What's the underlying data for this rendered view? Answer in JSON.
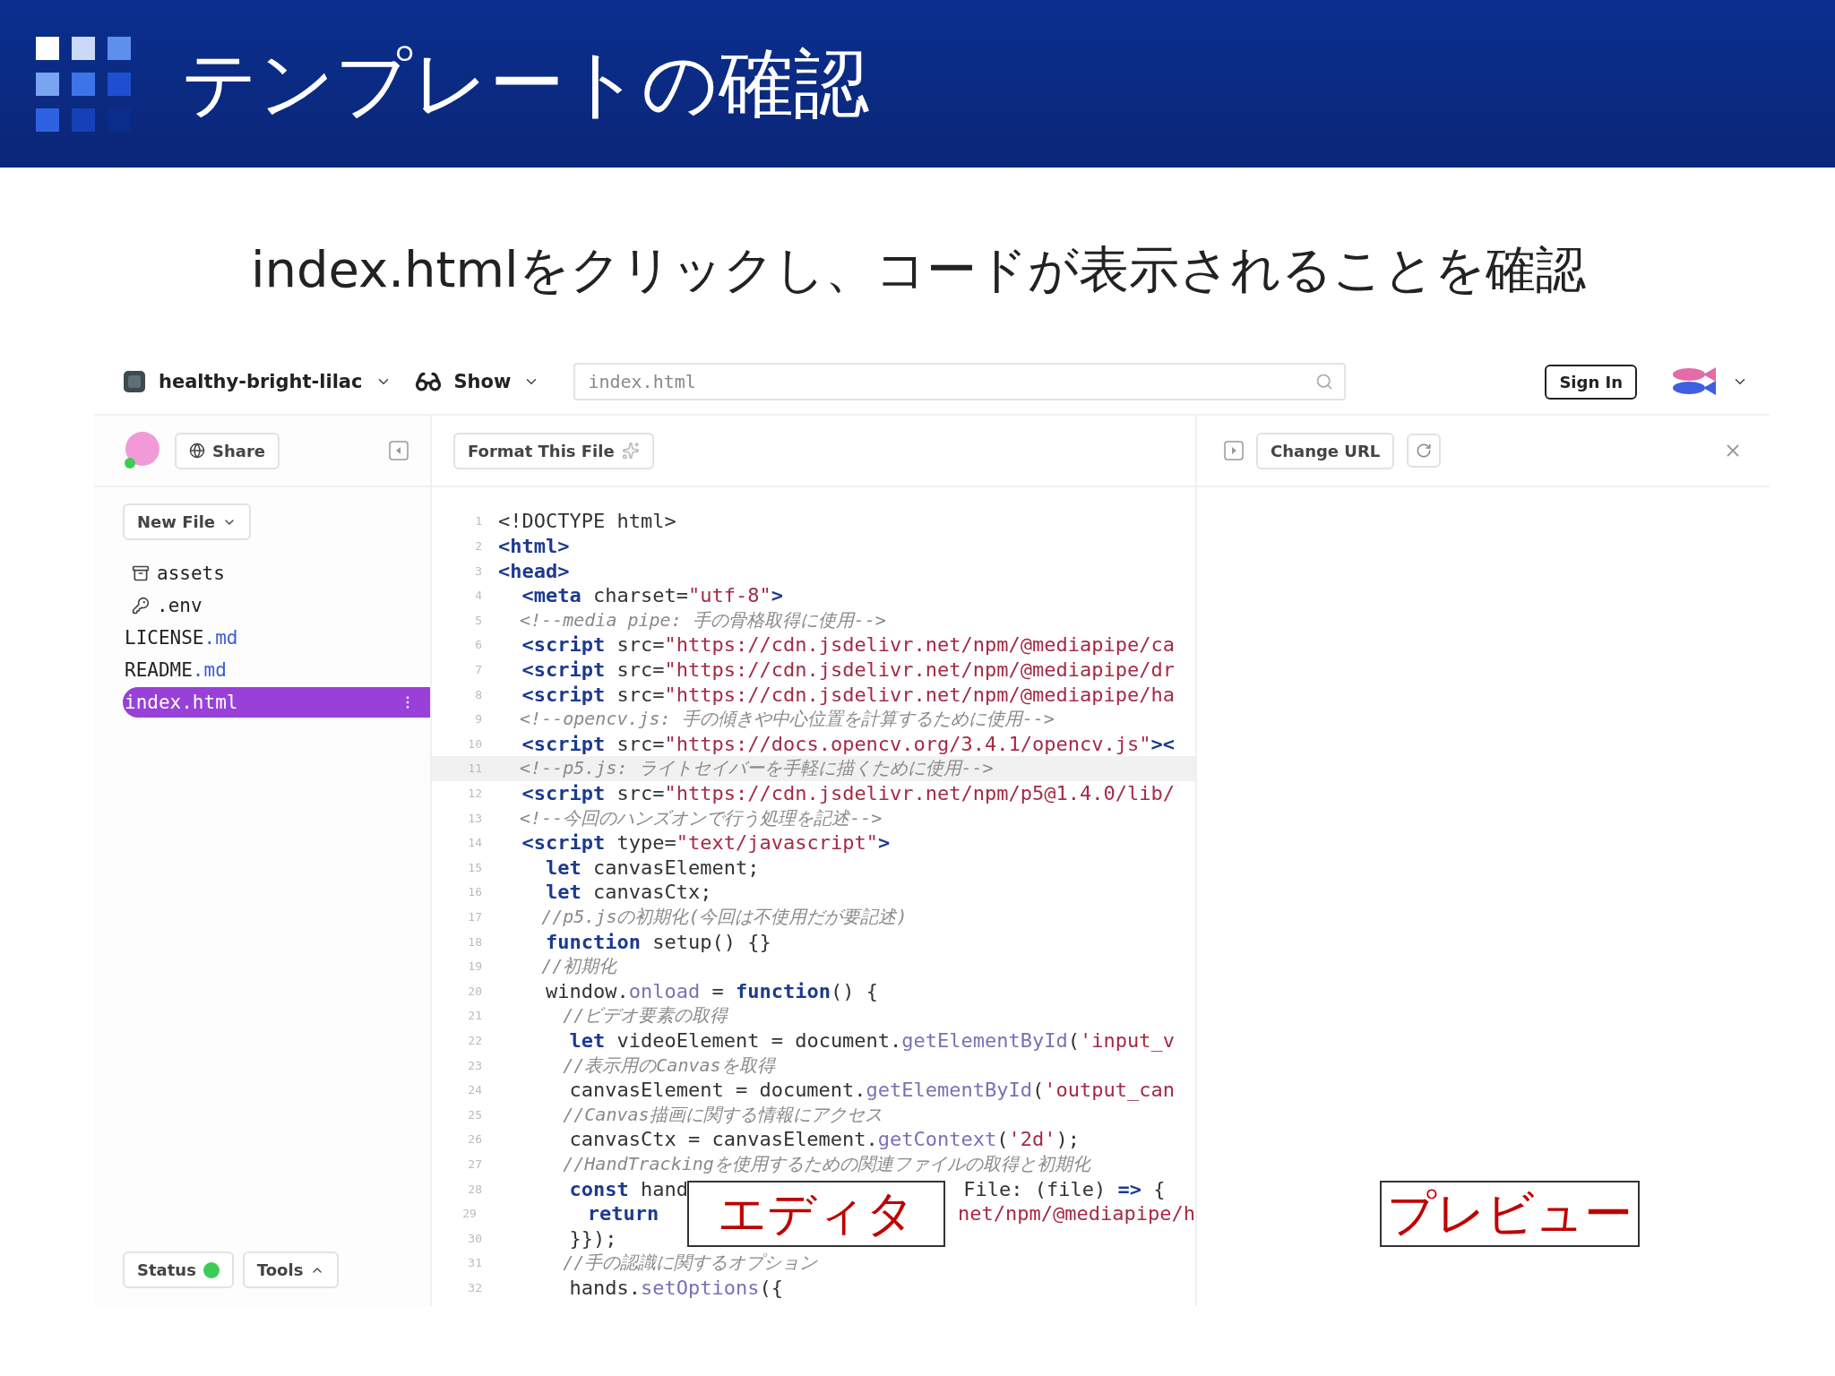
{
  "slide": {
    "title": "テンプレートの確認",
    "subtitle": "index.htmlをクリックし、コードが表示されることを確認"
  },
  "topbar": {
    "project": "healthy-bright-lilac",
    "show": "Show",
    "search": {
      "value": "index.html"
    },
    "sign_in": "Sign In"
  },
  "sidebar": {
    "share": "Share",
    "new_file": "New File",
    "status": "Status",
    "tools": "Tools",
    "files": [
      {
        "kind": "folder",
        "name": "assets",
        "selected": false
      },
      {
        "kind": "env",
        "name": ".env",
        "selected": false
      },
      {
        "kind": "file",
        "name": "LICENSE",
        "ext": ".md",
        "selected": false
      },
      {
        "kind": "file",
        "name": "README",
        "ext": ".md",
        "selected": false
      },
      {
        "kind": "file",
        "name": "index.html",
        "selected": true
      }
    ]
  },
  "editor": {
    "format_button": "Format This File",
    "lines": [
      {
        "number": "1",
        "current": false,
        "tokens": [
          {
            "kind": "plain",
            "text": "<!DOCTYPE html>"
          }
        ]
      },
      {
        "number": "2",
        "current": false,
        "tokens": [
          {
            "kind": "tag",
            "text": "<html>"
          }
        ]
      },
      {
        "number": "3",
        "current": false,
        "tokens": [
          {
            "kind": "tag",
            "text": "<head>"
          }
        ]
      },
      {
        "number": "4",
        "current": false,
        "tokens": [
          {
            "kind": "tag",
            "text": "  <meta"
          },
          {
            "kind": "plain",
            "text": " charset="
          },
          {
            "kind": "string",
            "text": "\"utf-8\""
          },
          {
            "kind": "tag",
            "text": ">"
          }
        ]
      },
      {
        "number": "5",
        "current": false,
        "tokens": [
          {
            "kind": "comment",
            "text": "  <!--media pipe: 手の骨格取得に使用-->"
          }
        ]
      },
      {
        "number": "6",
        "current": false,
        "tokens": [
          {
            "kind": "tag",
            "text": "  <script"
          },
          {
            "kind": "plain",
            "text": " src="
          },
          {
            "kind": "string",
            "text": "\"https://cdn.jsdelivr.net/npm/@mediapipe/ca"
          }
        ]
      },
      {
        "number": "7",
        "current": false,
        "tokens": [
          {
            "kind": "tag",
            "text": "  <script"
          },
          {
            "kind": "plain",
            "text": " src="
          },
          {
            "kind": "string",
            "text": "\"https://cdn.jsdelivr.net/npm/@mediapipe/dr"
          }
        ]
      },
      {
        "number": "8",
        "current": false,
        "tokens": [
          {
            "kind": "tag",
            "text": "  <script"
          },
          {
            "kind": "plain",
            "text": " src="
          },
          {
            "kind": "string",
            "text": "\"https://cdn.jsdelivr.net/npm/@mediapipe/ha"
          }
        ]
      },
      {
        "number": "9",
        "current": false,
        "tokens": [
          {
            "kind": "comment",
            "text": "  <!--opencv.js: 手の傾きや中心位置を計算するために使用-->"
          }
        ]
      },
      {
        "number": "10",
        "current": false,
        "tokens": [
          {
            "kind": "tag",
            "text": "  <script"
          },
          {
            "kind": "plain",
            "text": " src="
          },
          {
            "kind": "string",
            "text": "\"https://docs.opencv.org/3.4.1/opencv.js\""
          },
          {
            "kind": "tag",
            "text": "><"
          }
        ]
      },
      {
        "number": "11",
        "current": true,
        "tokens": [
          {
            "kind": "comment",
            "text": "  <!--p5.js: ライトセイバーを手軽に描くために使用-->"
          }
        ]
      },
      {
        "number": "12",
        "current": false,
        "tokens": [
          {
            "kind": "tag",
            "text": "  <script"
          },
          {
            "kind": "plain",
            "text": " src="
          },
          {
            "kind": "string",
            "text": "\"https://cdn.jsdelivr.net/npm/p5@1.4.0/lib/"
          }
        ]
      },
      {
        "number": "13",
        "current": false,
        "tokens": [
          {
            "kind": "comment",
            "text": "  <!--今回のハンズオンで行う処理を記述-->"
          }
        ]
      },
      {
        "number": "14",
        "current": false,
        "tokens": [
          {
            "kind": "tag",
            "text": "  <script"
          },
          {
            "kind": "plain",
            "text": " type="
          },
          {
            "kind": "string",
            "text": "\"text/javascript\""
          },
          {
            "kind": "tag",
            "text": ">"
          }
        ]
      },
      {
        "number": "15",
        "current": false,
        "tokens": [
          {
            "kind": "keyword",
            "text": "    let"
          },
          {
            "kind": "plain",
            "text": " canvasElement;"
          }
        ]
      },
      {
        "number": "16",
        "current": false,
        "tokens": [
          {
            "kind": "keyword",
            "text": "    let"
          },
          {
            "kind": "plain",
            "text": " canvasCtx;"
          }
        ]
      },
      {
        "number": "17",
        "current": false,
        "tokens": [
          {
            "kind": "comment",
            "text": "    //p5.jsの初期化(今回は不使用だが要記述)"
          }
        ]
      },
      {
        "number": "18",
        "current": false,
        "tokens": [
          {
            "kind": "keyword",
            "text": "    function"
          },
          {
            "kind": "plain",
            "text": " setup() {}"
          }
        ]
      },
      {
        "number": "19",
        "current": false,
        "tokens": [
          {
            "kind": "comment",
            "text": "    //初期化"
          }
        ]
      },
      {
        "number": "20",
        "current": false,
        "tokens": [
          {
            "kind": "plain",
            "text": "    window."
          },
          {
            "kind": "method",
            "text": "onload"
          },
          {
            "kind": "plain",
            "text": " = "
          },
          {
            "kind": "keyword",
            "text": "function"
          },
          {
            "kind": "plain",
            "text": "() {"
          }
        ]
      },
      {
        "number": "21",
        "current": false,
        "tokens": [
          {
            "kind": "comment",
            "text": "      //ビデオ要素の取得"
          }
        ]
      },
      {
        "number": "22",
        "current": false,
        "tokens": [
          {
            "kind": "keyword",
            "text": "      let"
          },
          {
            "kind": "plain",
            "text": " videoElement = document."
          },
          {
            "kind": "method",
            "text": "getElementById"
          },
          {
            "kind": "plain",
            "text": "("
          },
          {
            "kind": "string",
            "text": "'input_v"
          }
        ]
      },
      {
        "number": "23",
        "current": false,
        "tokens": [
          {
            "kind": "comment",
            "text": "      //表示用のCanvasを取得"
          }
        ]
      },
      {
        "number": "24",
        "current": false,
        "tokens": [
          {
            "kind": "plain",
            "text": "      canvasElement = document."
          },
          {
            "kind": "method",
            "text": "getElementById"
          },
          {
            "kind": "plain",
            "text": "("
          },
          {
            "kind": "string",
            "text": "'output_can"
          }
        ]
      },
      {
        "number": "25",
        "current": false,
        "tokens": [
          {
            "kind": "comment",
            "text": "      //Canvas描画に関する情報にアクセス"
          }
        ]
      },
      {
        "number": "26",
        "current": false,
        "tokens": [
          {
            "kind": "plain",
            "text": "      canvasCtx = canvasElement."
          },
          {
            "kind": "method",
            "text": "getContext"
          },
          {
            "kind": "plain",
            "text": "("
          },
          {
            "kind": "string",
            "text": "'2d'"
          },
          {
            "kind": "plain",
            "text": ");"
          }
        ]
      },
      {
        "number": "27",
        "current": false,
        "tokens": [
          {
            "kind": "comment",
            "text": "      //HandTrackingを使用するための関連ファイルの取得と初期化"
          }
        ]
      },
      {
        "number": "28",
        "current": false,
        "tokens": [
          {
            "kind": "keyword",
            "text": "      const"
          },
          {
            "kind": "plain",
            "text": " hand"
          }
        ],
        "right": [
          {
            "kind": "plain",
            "text": "File: (file) "
          },
          {
            "kind": "keyword",
            "text": "=>"
          },
          {
            "kind": "plain",
            "text": " {"
          }
        ]
      },
      {
        "number": "29",
        "current": false,
        "tokens": [
          {
            "kind": "keyword",
            "text": "        return"
          }
        ],
        "right": [
          {
            "kind": "string",
            "text": "net/npm/@mediapipe/h"
          }
        ]
      },
      {
        "number": "30",
        "current": false,
        "tokens": [
          {
            "kind": "plain",
            "text": "      }});"
          }
        ]
      },
      {
        "number": "31",
        "current": false,
        "tokens": [
          {
            "kind": "comment",
            "text": "      //手の認識に関するオプション"
          }
        ]
      },
      {
        "number": "32",
        "current": false,
        "tokens": [
          {
            "kind": "plain",
            "text": "      hands."
          },
          {
            "kind": "method",
            "text": "setOptions"
          },
          {
            "kind": "plain",
            "text": "({"
          }
        ]
      }
    ]
  },
  "preview": {
    "change_url": "Change URL"
  },
  "callouts": [
    {
      "label": "エディタ"
    },
    {
      "label": "プレビュー"
    }
  ]
}
